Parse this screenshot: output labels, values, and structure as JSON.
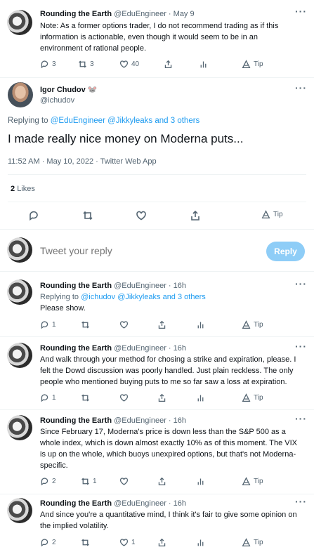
{
  "top_tweet": {
    "name": "Rounding the Earth",
    "handle_date": "@EduEngineer · May 9",
    "text_lines": [
      "Note: As a former options trader, I do not recommend trading as if this",
      "information is actionable, even though it would seem to be in an",
      "environment of rational people."
    ],
    "replies": "3",
    "retweets": "3",
    "likes": "40",
    "tip": "Tip"
  },
  "main_tweet": {
    "name": "Igor Chudov",
    "emoji": "🐭",
    "handle": "@ichudov",
    "replying_prefix": "Replying to ",
    "replying_links": "@EduEngineer @Jikkyleaks and 3 others",
    "text": "I made really nice money on Moderna puts...",
    "timestamp": "11:52 AM · May 10, 2022 · Twitter Web App",
    "likes_count": "2",
    "likes_label": "Likes",
    "tip": "Tip"
  },
  "composer": {
    "placeholder": "Tweet your reply",
    "button": "Reply"
  },
  "replies": [
    {
      "name": "Rounding the Earth",
      "meta": "@EduEngineer · 16h",
      "replying_prefix": "Replying to ",
      "replying_links": "@ichudov @Jikkyleaks and 3 others",
      "text_lines": [
        "Please show."
      ],
      "replies": "1",
      "retweets": "",
      "likes": "",
      "tip": "Tip"
    },
    {
      "name": "Rounding the Earth",
      "meta": "@EduEngineer · 16h",
      "text_lines": [
        "And walk through your method for chosing a strike and expiration, please. I",
        "felt the Dowd discussion was poorly handled. Just plain reckless. The only",
        "people who mentioned buying puts to me so far saw a loss at expiration."
      ],
      "replies": "1",
      "retweets": "",
      "likes": "",
      "tip": "Tip"
    },
    {
      "name": "Rounding the Earth",
      "meta": "@EduEngineer · 16h",
      "text_lines": [
        "Since February 17, Moderna's price is down less than the S&P 500 as a",
        "whole index, which is down almost exactly 10% as of this moment. The VIX",
        "is up on the whole, which buoys unexpired options, but that's not Moderna-",
        "specific."
      ],
      "replies": "2",
      "retweets": "1",
      "likes": "",
      "tip": "Tip"
    },
    {
      "name": "Rounding the Earth",
      "meta": "@EduEngineer · 16h",
      "text_lines": [
        "And since you're a quantitative mind, I think it's fair to give some opinion on",
        "the implied volatility."
      ],
      "replies": "2",
      "retweets": "",
      "likes": "1",
      "tip": "Tip"
    }
  ],
  "more_label": "···"
}
